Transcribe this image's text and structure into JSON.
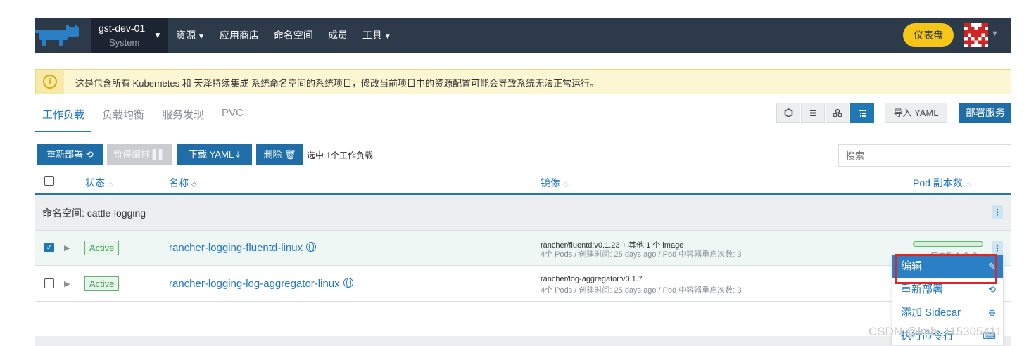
{
  "nav": {
    "cluster_name": "gst-dev-01",
    "cluster_sub": "System",
    "items": [
      {
        "label": "资源",
        "has_caret": true
      },
      {
        "label": "应用商店",
        "has_caret": false
      },
      {
        "label": "命名空间",
        "has_caret": false
      },
      {
        "label": "成员",
        "has_caret": false
      },
      {
        "label": "工具",
        "has_caret": true
      }
    ],
    "dashboard_label": "仪表盘",
    "caret": "❯"
  },
  "banner": {
    "icon": "i",
    "text": "这是包含所有 Kubernetes 和 天泽持续集成 系统命名空间的系统项目，修改当前项目中的资源配置可能会导致系统无法正常运行。"
  },
  "tabs": [
    "工作负载",
    "负载均衡",
    "服务发现",
    "PVC"
  ],
  "toolbar": {
    "import_label": "导入 YAML",
    "deploy_label": "部署服务"
  },
  "actions": {
    "redeploy": "重新部署 ⟲",
    "pause": "暂停编排 ▌▌",
    "download": "下载 YAML ⤓",
    "delete": "删除 🗑",
    "selection": "选中 1个工作负载",
    "search_placeholder": "搜索"
  },
  "table": {
    "headers": {
      "state": "状态",
      "name": "名称",
      "image": "镜像",
      "pods": "Pod 副本数"
    },
    "namespace_label": "命名空间: cattle-logging",
    "rows": [
      {
        "checked": true,
        "state": "Active",
        "name": "rancher-logging-fluentd-linux",
        "image": "rancher/fluentd:v0.1.23 + 其他 1 个 image",
        "meta": "4个 Pods / 创建时间: 25 days ago / Pod 中容器重启次数: 3",
        "pods": "每主机 1 个 Pod"
      },
      {
        "checked": false,
        "state": "Active",
        "name": "rancher-logging-log-aggregator-linux",
        "image": "rancher/log-aggregator:v0.1.7",
        "meta": "4个 Pods / 创建时间: 25 days ago / Pod 中容器重启次数: 3",
        "pods": ""
      }
    ]
  },
  "menu": {
    "items": [
      {
        "label": "编辑",
        "icon": "✎"
      },
      {
        "label": "重新部署",
        "icon": "⟲"
      },
      {
        "label": "添加 Sidecar",
        "icon": "⊕"
      },
      {
        "label": "执行命令行",
        "icon": "⌨"
      }
    ]
  },
  "watermark": "CSDN @lmb_115305411"
}
